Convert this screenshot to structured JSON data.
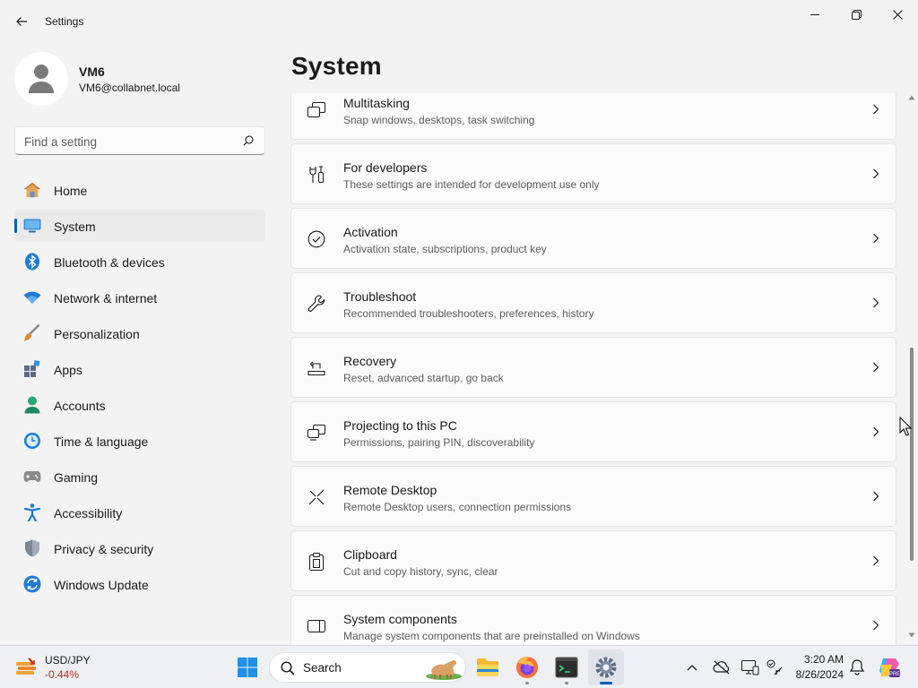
{
  "window": {
    "title": "Settings"
  },
  "user": {
    "name": "VM6",
    "email": "VM6@collabnet.local"
  },
  "search": {
    "placeholder": "Find a setting"
  },
  "nav": {
    "items": [
      {
        "label": "Home",
        "icon": "home-icon"
      },
      {
        "label": "System",
        "icon": "system-icon",
        "selected": true
      },
      {
        "label": "Bluetooth & devices",
        "icon": "bluetooth-icon"
      },
      {
        "label": "Network & internet",
        "icon": "wifi-icon"
      },
      {
        "label": "Personalization",
        "icon": "brush-icon"
      },
      {
        "label": "Apps",
        "icon": "apps-icon"
      },
      {
        "label": "Accounts",
        "icon": "accounts-icon"
      },
      {
        "label": "Time & language",
        "icon": "clock-globe-icon"
      },
      {
        "label": "Gaming",
        "icon": "gamepad-icon"
      },
      {
        "label": "Accessibility",
        "icon": "accessibility-icon"
      },
      {
        "label": "Privacy & security",
        "icon": "shield-icon"
      },
      {
        "label": "Windows Update",
        "icon": "update-icon"
      }
    ]
  },
  "main": {
    "title": "System",
    "cards": [
      {
        "title": "Multitasking",
        "description": "Snap windows, desktops, task switching",
        "icon": "multitasking-icon"
      },
      {
        "title": "For developers",
        "description": "These settings are intended for development use only",
        "icon": "developer-tools-icon"
      },
      {
        "title": "Activation",
        "description": "Activation state, subscriptions, product key",
        "icon": "check-circle-icon"
      },
      {
        "title": "Troubleshoot",
        "description": "Recommended troubleshooters, preferences, history",
        "icon": "wrench-icon"
      },
      {
        "title": "Recovery",
        "description": "Reset, advanced startup, go back",
        "icon": "recovery-icon"
      },
      {
        "title": "Projecting to this PC",
        "description": "Permissions, pairing PIN, discoverability",
        "icon": "projecting-icon"
      },
      {
        "title": "Remote Desktop",
        "description": "Remote Desktop users, connection permissions",
        "icon": "remote-desktop-icon"
      },
      {
        "title": "Clipboard",
        "description": "Cut and copy history, sync, clear",
        "icon": "clipboard-icon"
      },
      {
        "title": "System components",
        "description": "Manage system components that are preinstalled on Windows",
        "icon": "system-components-icon"
      }
    ]
  },
  "taskbar": {
    "widget": {
      "title": "USD/JPY",
      "change": "-0.44%"
    },
    "search_label": "Search",
    "apps": [
      "start-icon",
      "file-explorer-icon",
      "firefox-icon",
      "terminal-icon",
      "settings-icon"
    ],
    "tray_icons": [
      "chevron-up-icon",
      "onedrive-icon",
      "display-icon",
      "network-icon"
    ],
    "clock": {
      "time": "3:20 AM",
      "date": "8/26/2024"
    },
    "notification_icon": "bell-icon",
    "copilot_icon": "copilot-icon"
  },
  "colors": {
    "accent": "#005fb8",
    "background": "#f3f3f3",
    "card": "#fbfbfb",
    "negative": "#c42b1c"
  }
}
